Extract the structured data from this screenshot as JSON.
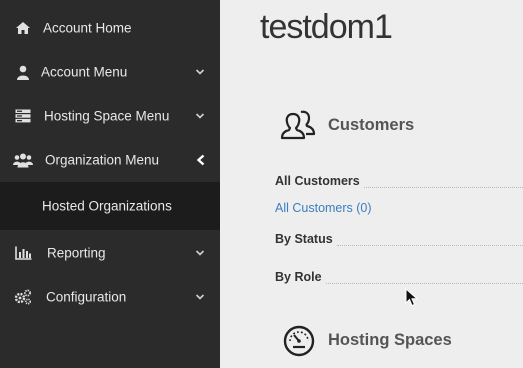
{
  "sidebar": {
    "items": [
      {
        "label": "Account Home",
        "icon": "home-icon"
      },
      {
        "label": "Account Menu",
        "icon": "user-icon"
      },
      {
        "label": "Hosting Space Menu",
        "icon": "server-icon"
      },
      {
        "label": "Organization Menu",
        "icon": "users-icon"
      },
      {
        "label": "Reporting",
        "icon": "bar-chart-icon"
      },
      {
        "label": "Configuration",
        "icon": "gears-icon"
      }
    ],
    "submenu": {
      "label": "Hosted Organizations"
    }
  },
  "main": {
    "title": "testdom1",
    "customers": {
      "title": "Customers",
      "groups": {
        "all": "All Customers",
        "all_link": "All Customers (0)",
        "by_status": "By Status",
        "by_role": "By Role"
      }
    },
    "hosting_spaces": {
      "title": "Hosting Spaces"
    }
  },
  "colors": {
    "sidebar_bg": "#2b2b2b",
    "submenu_bg": "#1c1c1c",
    "link": "#3a7fc1",
    "content_bg": "#eeeeee"
  }
}
